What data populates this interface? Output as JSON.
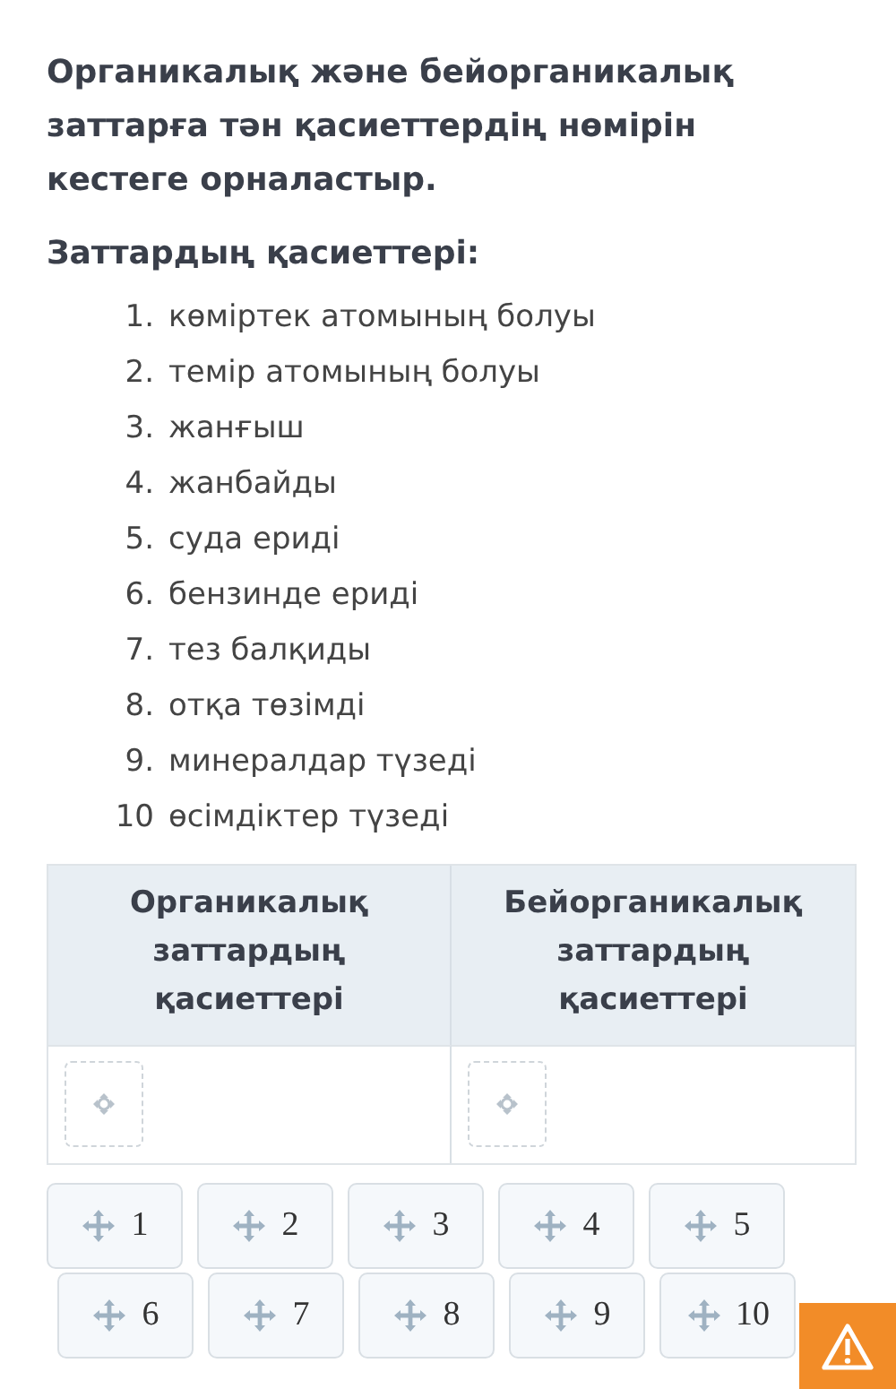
{
  "instruction": "Органикалық және бейорганикалық заттарға тән қасиеттердің нөмірін кестеге орналастыр.",
  "list_title": "Заттардың қасиеттері:",
  "properties": [
    {
      "number": "1.",
      "text": "көміртек атомының болуы"
    },
    {
      "number": "2.",
      "text": "темір атомының болуы"
    },
    {
      "number": "3.",
      "text": "жанғыш"
    },
    {
      "number": "4.",
      "text": "жанбайды"
    },
    {
      "number": "5.",
      "text": "суда ериді"
    },
    {
      "number": "6.",
      "text": "бензинде ериді"
    },
    {
      "number": "7.",
      "text": "тез балқиды"
    },
    {
      "number": "8.",
      "text": "отқа төзімді"
    },
    {
      "number": "9.",
      "text": "минералдар түзеді"
    },
    {
      "number": "10",
      "text": "өсімдіктер түзеді"
    }
  ],
  "table": {
    "columns": [
      "Органикалық заттардың қасиеттері",
      "Бейорганикалық заттардың қасиеттері"
    ]
  },
  "tiles": [
    [
      "1",
      "2",
      "3",
      "4",
      "5"
    ],
    [
      "6",
      "7",
      "8",
      "9",
      "10"
    ]
  ]
}
